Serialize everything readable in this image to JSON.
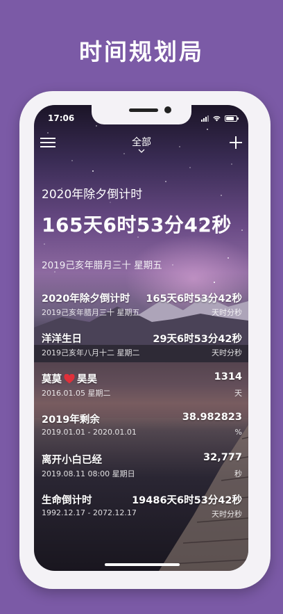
{
  "headline": "时间规划局",
  "status_bar": {
    "time": "17:06"
  },
  "nav": {
    "filter_label": "全部"
  },
  "hero": {
    "title": "2020年除夕倒计时",
    "value": "165天6时53分42秒",
    "subtitle": "2019己亥年腊月三十  星期五"
  },
  "events": [
    {
      "title": "2020年除夕倒计时",
      "value": "165天6时53分42秒",
      "subtitle": "2019己亥年腊月三十  星期五",
      "unit": "天时分秒"
    },
    {
      "title": "洋洋生日",
      "value": "29天6时53分42秒",
      "subtitle": "2019己亥年八月十二  星期二",
      "unit": "天时分秒"
    },
    {
      "title_left": "莫莫",
      "title_right": "昊昊",
      "value": "1314",
      "subtitle": "2016.01.05  星期二",
      "unit": "天"
    },
    {
      "title": "2019年剩余",
      "value": "38.982823",
      "subtitle": "2019.01.01 - 2020.01.01",
      "unit": "%"
    },
    {
      "title": "离开小白已经",
      "value": "32,777",
      "subtitle": "2019.08.11 08:00  星期日",
      "unit": "秒"
    },
    {
      "title": "生命倒计时",
      "value": "19486天6时53分42秒",
      "subtitle": "1992.12.17  - 2072.12.17",
      "unit": "天时分秒"
    }
  ],
  "icons": {
    "menu": "menu-icon",
    "add": "plus-icon",
    "chevron": "chevron-down-icon",
    "heart": "heart-icon"
  },
  "colors": {
    "background": "#7b5aa6",
    "heart": "#e0303a"
  }
}
